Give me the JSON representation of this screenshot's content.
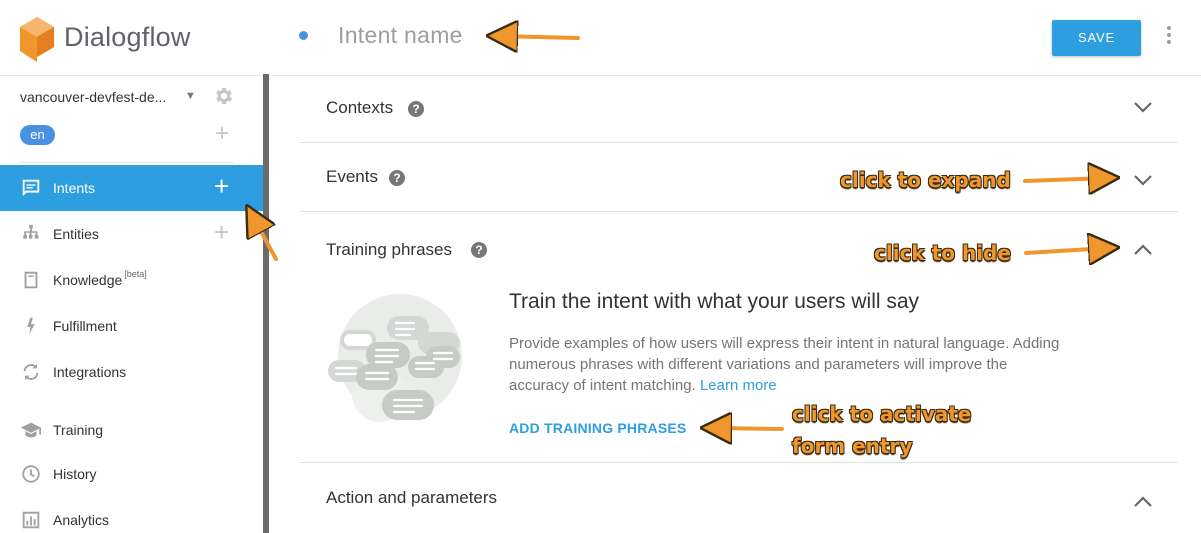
{
  "brand": {
    "name": "Dialogflow"
  },
  "agent": {
    "name": "vancouver-devfest-de...",
    "language": "en"
  },
  "sidebar": {
    "items": [
      {
        "label": "Intents",
        "icon": "chat-icon",
        "active": true,
        "plus": true
      },
      {
        "label": "Entities",
        "icon": "sitemap-icon",
        "active": false,
        "plus": true
      },
      {
        "label": "Knowledge",
        "badge": "[beta]",
        "icon": "book-icon",
        "active": false,
        "plus": false
      },
      {
        "label": "Fulfillment",
        "icon": "bolt-icon",
        "active": false,
        "plus": false
      },
      {
        "label": "Integrations",
        "icon": "refresh-icon",
        "active": false,
        "plus": false
      },
      {
        "label": "Training",
        "icon": "mortarboard-icon",
        "active": false,
        "plus": false
      },
      {
        "label": "History",
        "icon": "clock-icon",
        "active": false,
        "plus": false
      },
      {
        "label": "Analytics",
        "icon": "bar-chart-icon",
        "active": false,
        "plus": false
      }
    ]
  },
  "header": {
    "intent_placeholder": "Intent name",
    "save_label": "SAVE"
  },
  "sections": {
    "contexts": {
      "title": "Contexts",
      "expanded": false
    },
    "events": {
      "title": "Events",
      "expanded": false
    },
    "training": {
      "title": "Training phrases",
      "expanded": true,
      "heading": "Train the intent with what your users will say",
      "description": "Provide examples of how users will express their intent in natural language. Adding numerous phrases with different variations and parameters will improve the accuracy of intent matching.",
      "learn_more": "Learn more",
      "add_button": "ADD TRAINING PHRASES"
    },
    "action": {
      "title": "Action and parameters",
      "expanded": true
    }
  },
  "annotations": {
    "expand": "click to expand",
    "hide": "click to hide",
    "activate_line1": "click to activate",
    "activate_line2": "form entry"
  },
  "colors": {
    "accent": "#2d9ee0",
    "annotation": "#f0962e",
    "logo": "#f0962e"
  }
}
